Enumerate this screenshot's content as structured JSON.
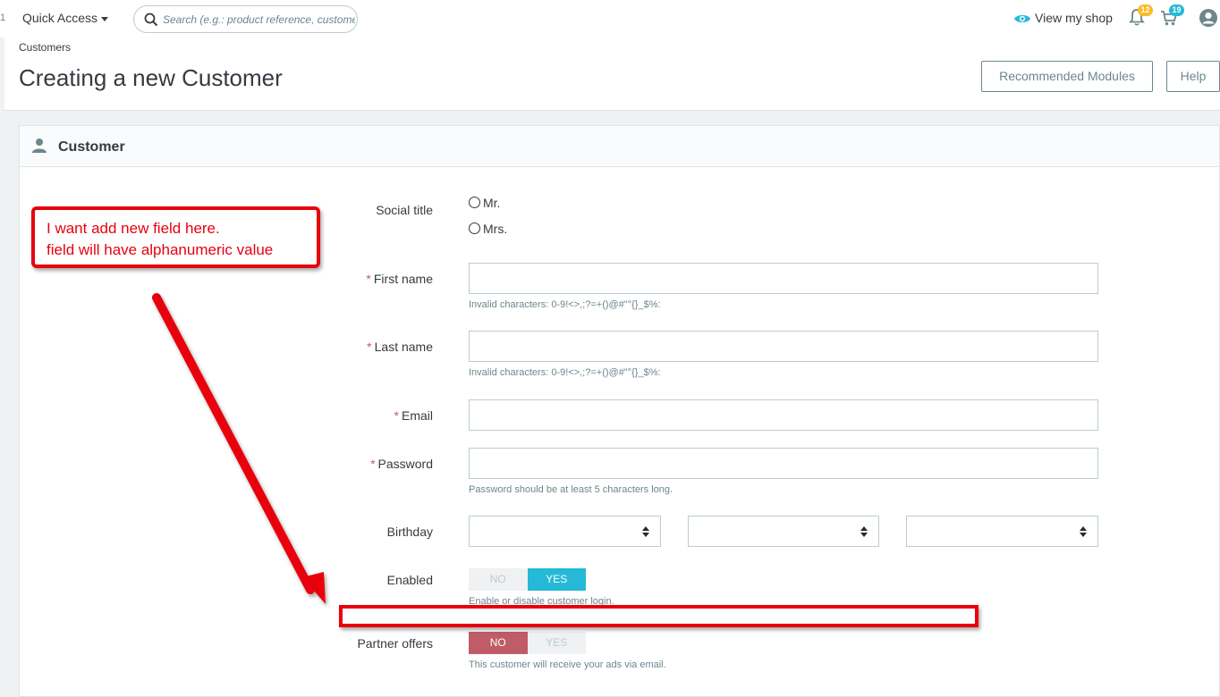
{
  "topbar": {
    "edge_number": "1",
    "quick_access": "Quick Access",
    "search_placeholder": "Search (e.g.: product reference, customer name…)",
    "view_my_shop": "View my shop",
    "notifications_count": "12",
    "orders_count": "19",
    "colors": {
      "accent": "#25b9d7",
      "badge_orange": "#fbbb22"
    }
  },
  "header": {
    "breadcrumb": "Customers",
    "title": "Creating a new Customer",
    "recommended_modules": "Recommended Modules",
    "help": "Help"
  },
  "panel": {
    "title": "Customer",
    "icon": "person-icon"
  },
  "form": {
    "social_title": {
      "label": "Social title",
      "options": [
        "Mr.",
        "Mrs."
      ]
    },
    "first_name": {
      "label": "First name",
      "value": "",
      "hint": "Invalid characters: 0-9!<>,;?=+()@#\"°{}_$%:"
    },
    "last_name": {
      "label": "Last name",
      "value": "",
      "hint": "Invalid characters: 0-9!<>,;?=+()@#\"°{}_$%:"
    },
    "email": {
      "label": "Email",
      "value": ""
    },
    "password": {
      "label": "Password",
      "value": "",
      "hint": "Password should be at least 5 characters long."
    },
    "birthday": {
      "label": "Birthday",
      "day": "",
      "month": "",
      "year": ""
    },
    "enabled": {
      "label": "Enabled",
      "no": "NO",
      "yes": "YES",
      "selected": "YES",
      "hint": "Enable or disable customer login."
    },
    "partner_offers": {
      "label": "Partner offers",
      "no": "NO",
      "yes": "YES",
      "selected": "NO",
      "hint": "This customer will receive your ads via email."
    },
    "required_mark": "*"
  },
  "annotation": {
    "line1": "I want add new field here.",
    "line2": "field will have alphanumeric value",
    "color": "#e8000d"
  }
}
